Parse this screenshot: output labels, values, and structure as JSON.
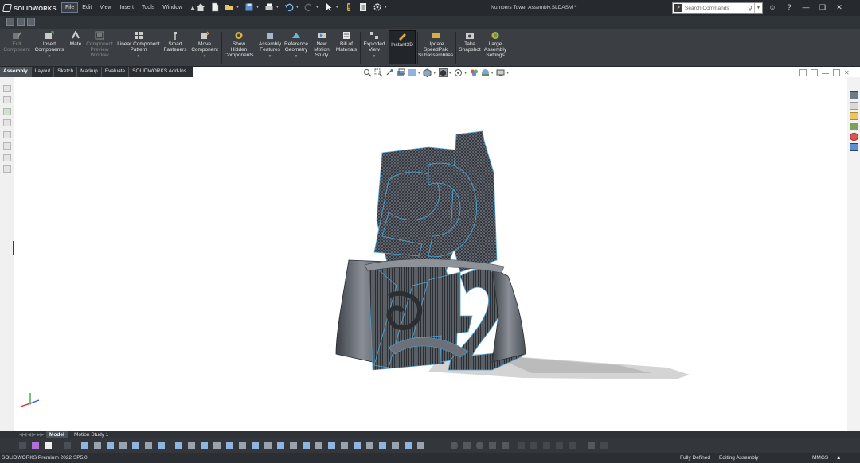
{
  "app": {
    "logo_text": "SOLIDWORKS",
    "document_title": "Numbers Tower Assembly.SLDASM *"
  },
  "menu": [
    "File",
    "Edit",
    "View",
    "Insert",
    "Tools",
    "Window"
  ],
  "search": {
    "placeholder": "Search Commands"
  },
  "commands": [
    {
      "label": "Edit Component",
      "enabled": false
    },
    {
      "label": "Insert Components",
      "enabled": true
    },
    {
      "label": "Mate",
      "enabled": true
    },
    {
      "label": "Component Preview Window",
      "enabled": false
    },
    {
      "label": "Linear Component Pattern",
      "enabled": true
    },
    {
      "label": "Smart Fasteners",
      "enabled": true
    },
    {
      "label": "Move Component",
      "enabled": true
    },
    {
      "label": "Show Hidden Components",
      "enabled": true
    },
    {
      "label": "Assembly Features",
      "enabled": true
    },
    {
      "label": "Reference Geometry",
      "enabled": true
    },
    {
      "label": "New Motion Study",
      "enabled": true
    },
    {
      "label": "Bill of Materials",
      "enabled": true
    },
    {
      "label": "Exploded View",
      "enabled": true
    },
    {
      "label": "Instant3D",
      "enabled": true,
      "active": true
    },
    {
      "label": "Update SpeedPak Subassemblies",
      "enabled": true
    },
    {
      "label": "Take Snapshot",
      "enabled": true
    },
    {
      "label": "Large Assembly Settings",
      "enabled": true
    }
  ],
  "tabs": [
    "Assembly",
    "Layout",
    "Sketch",
    "Markup",
    "Evaluate",
    "SOLIDWORKS Add-Ins"
  ],
  "bottom_tabs": [
    "Model",
    "Motion Study 1"
  ],
  "status": {
    "product": "SOLIDWORKS Premium 2022 SP5.0",
    "definition": "Fully Defined",
    "mode": "Editing Assembly",
    "units": "MMGS"
  },
  "colors": {
    "titlebar": "#262a2e",
    "commandbar": "#3b3f44",
    "viewport": "#ffffff",
    "model_gray": "#5a5f66",
    "edge_blue": "#4fa8d8"
  },
  "icons": {
    "search": "magnifier-icon",
    "help": "help-icon",
    "user": "user-icon",
    "home": "home-icon",
    "new": "new-document-icon",
    "open": "open-folder-icon",
    "save": "save-icon",
    "print": "print-icon",
    "undo": "undo-icon",
    "select": "select-arrow-icon",
    "rebuild": "rebuild-icon",
    "options": "gear-icon"
  }
}
